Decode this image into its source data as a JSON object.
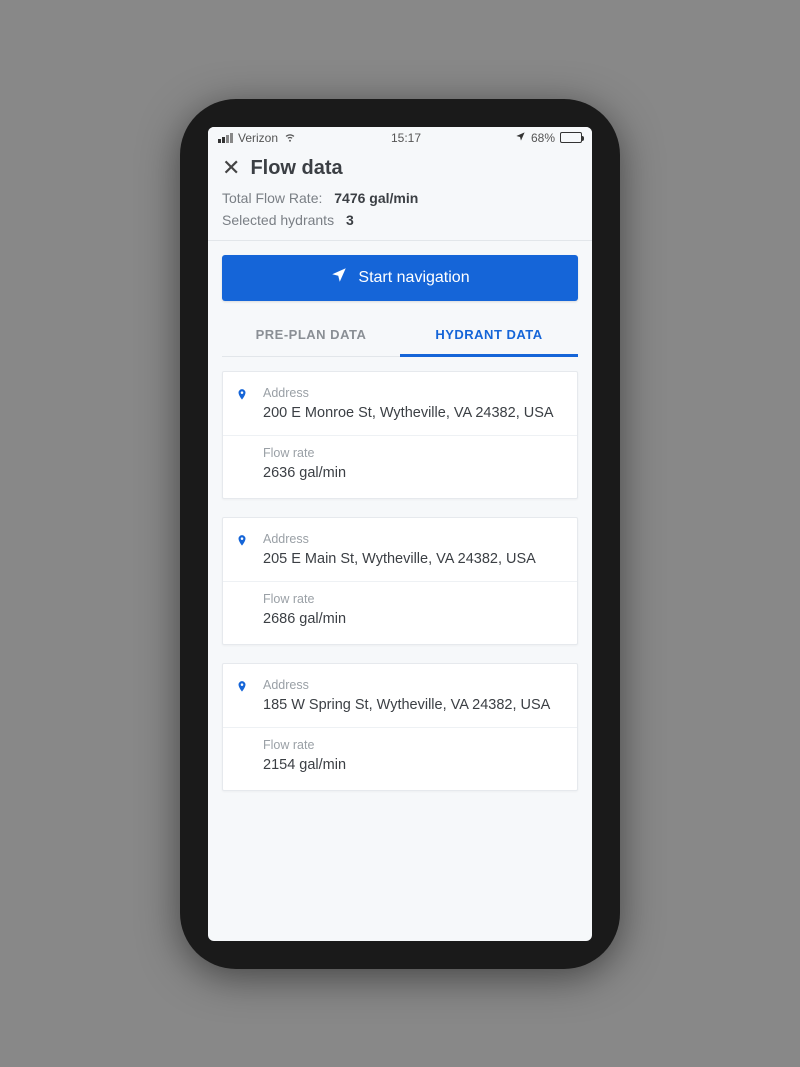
{
  "status_bar": {
    "carrier": "Verizon",
    "time": "15:17",
    "battery_percent": "68%",
    "battery_fill_pct": 68
  },
  "header": {
    "title": "Flow data",
    "total_flow_label": "Total Flow Rate:",
    "total_flow_value": "7476 gal/min",
    "selected_hydrants_label": "Selected hydrants",
    "selected_hydrants_value": "3"
  },
  "start_nav_label": "Start navigation",
  "tabs": {
    "preplan": "PRE-PLAN DATA",
    "hydrant": "HYDRANT DATA",
    "active": "hydrant"
  },
  "field_labels": {
    "address": "Address",
    "flow_rate": "Flow rate"
  },
  "hydrants": [
    {
      "address": "200 E Monroe St, Wytheville, VA 24382, USA",
      "flow_rate": "2636 gal/min"
    },
    {
      "address": "205 E Main St, Wytheville, VA 24382, USA",
      "flow_rate": "2686 gal/min"
    },
    {
      "address": "185 W Spring St, Wytheville, VA 24382, USA",
      "flow_rate": "2154 gal/min"
    }
  ]
}
